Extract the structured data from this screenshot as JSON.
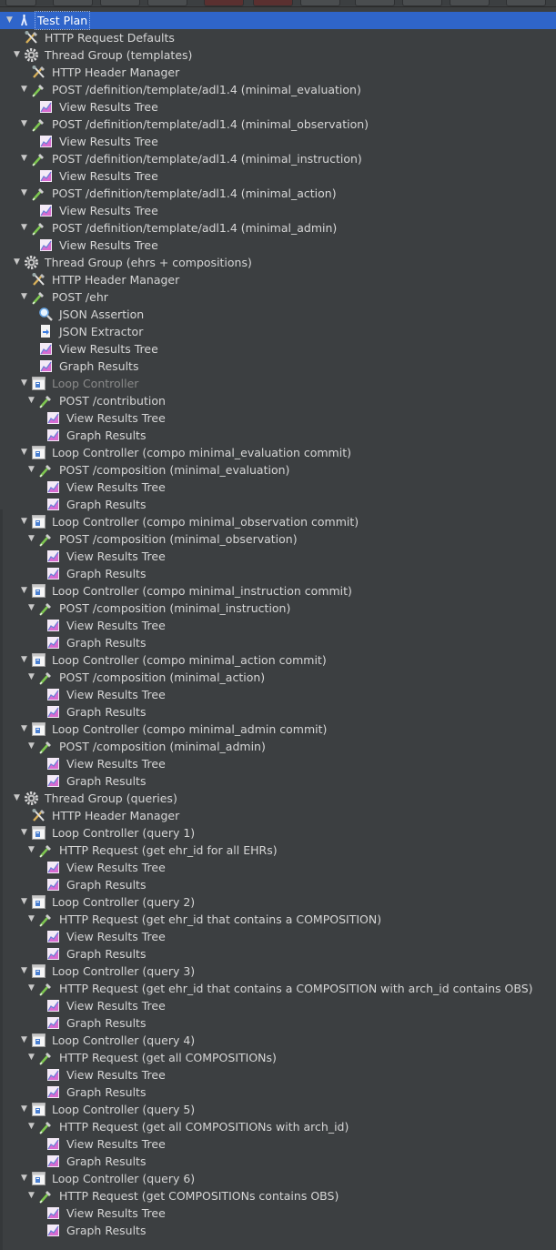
{
  "tree": [
    {
      "name": "test-plan-node",
      "icon": "test-plan-icon",
      "label": "Test Plan",
      "indent": 0,
      "toggle": "expanded",
      "selected": true
    },
    {
      "name": "http-request-defaults-node",
      "icon": "http-defaults-icon",
      "label": "HTTP Request Defaults",
      "indent": 1,
      "toggle": "none"
    },
    {
      "name": "thread-group-node",
      "icon": "gear-icon",
      "label": "Thread Group (templates)",
      "indent": 1,
      "toggle": "expanded"
    },
    {
      "name": "http-header-manager-node",
      "icon": "header-manager-icon",
      "label": "HTTP Header Manager",
      "indent": 2,
      "toggle": "none"
    },
    {
      "name": "sampler-node",
      "icon": "sampler-pipette-icon",
      "label": "POST /definition/template/adl1.4 (minimal_evaluation)",
      "indent": 2,
      "toggle": "expanded"
    },
    {
      "name": "view-results-tree-node",
      "icon": "listener-chart-icon",
      "label": "View Results Tree",
      "indent": 3,
      "toggle": "none"
    },
    {
      "name": "sampler-node",
      "icon": "sampler-pipette-icon",
      "label": "POST /definition/template/adl1.4 (minimal_observation)",
      "indent": 2,
      "toggle": "expanded"
    },
    {
      "name": "view-results-tree-node",
      "icon": "listener-chart-icon",
      "label": "View Results Tree",
      "indent": 3,
      "toggle": "none"
    },
    {
      "name": "sampler-node",
      "icon": "sampler-pipette-icon",
      "label": "POST /definition/template/adl1.4 (minimal_instruction)",
      "indent": 2,
      "toggle": "expanded"
    },
    {
      "name": "view-results-tree-node",
      "icon": "listener-chart-icon",
      "label": "View Results Tree",
      "indent": 3,
      "toggle": "none"
    },
    {
      "name": "sampler-node",
      "icon": "sampler-pipette-icon",
      "label": "POST /definition/template/adl1.4 (minimal_action)",
      "indent": 2,
      "toggle": "expanded"
    },
    {
      "name": "view-results-tree-node",
      "icon": "listener-chart-icon",
      "label": "View Results Tree",
      "indent": 3,
      "toggle": "none"
    },
    {
      "name": "sampler-node",
      "icon": "sampler-pipette-icon",
      "label": "POST /definition/template/adl1.4 (minimal_admin)",
      "indent": 2,
      "toggle": "expanded"
    },
    {
      "name": "view-results-tree-node",
      "icon": "listener-chart-icon",
      "label": "View Results Tree",
      "indent": 3,
      "toggle": "none"
    },
    {
      "name": "thread-group-node",
      "icon": "gear-icon",
      "label": "Thread Group (ehrs + compositions)",
      "indent": 1,
      "toggle": "expanded"
    },
    {
      "name": "http-header-manager-node",
      "icon": "header-manager-icon",
      "label": "HTTP Header Manager",
      "indent": 2,
      "toggle": "none"
    },
    {
      "name": "sampler-node",
      "icon": "sampler-pipette-icon",
      "label": "POST /ehr",
      "indent": 2,
      "toggle": "expanded"
    },
    {
      "name": "json-assertion-node",
      "icon": "json-assertion-icon",
      "label": "JSON Assertion",
      "indent": 3,
      "toggle": "none"
    },
    {
      "name": "json-extractor-node",
      "icon": "json-extractor-icon",
      "label": "JSON Extractor",
      "indent": 3,
      "toggle": "none"
    },
    {
      "name": "view-results-tree-node",
      "icon": "listener-chart-icon",
      "label": "View Results Tree",
      "indent": 3,
      "toggle": "none"
    },
    {
      "name": "graph-results-node",
      "icon": "listener-chart-icon",
      "label": "Graph Results",
      "indent": 3,
      "toggle": "none"
    },
    {
      "name": "loop-controller-node",
      "icon": "loop-controller-icon",
      "label": "Loop Controller",
      "indent": 2,
      "toggle": "expanded",
      "disabled": true
    },
    {
      "name": "sampler-node",
      "icon": "sampler-pipette-icon",
      "label": "POST /contribution",
      "indent": 3,
      "toggle": "expanded"
    },
    {
      "name": "view-results-tree-node",
      "icon": "listener-chart-icon",
      "label": "View Results Tree",
      "indent": 4,
      "toggle": "none"
    },
    {
      "name": "graph-results-node",
      "icon": "listener-chart-icon",
      "label": "Graph Results",
      "indent": 4,
      "toggle": "none"
    },
    {
      "name": "loop-controller-node",
      "icon": "loop-controller-icon",
      "label": "Loop Controller (compo minimal_evaluation commit)",
      "indent": 2,
      "toggle": "expanded"
    },
    {
      "name": "sampler-node",
      "icon": "sampler-pipette-icon",
      "label": "POST /composition (minimal_evaluation)",
      "indent": 3,
      "toggle": "expanded"
    },
    {
      "name": "view-results-tree-node",
      "icon": "listener-chart-icon",
      "label": "View Results Tree",
      "indent": 4,
      "toggle": "none"
    },
    {
      "name": "graph-results-node",
      "icon": "listener-chart-icon",
      "label": "Graph Results",
      "indent": 4,
      "toggle": "none"
    },
    {
      "name": "loop-controller-node",
      "icon": "loop-controller-icon",
      "label": "Loop Controller (compo minimal_observation commit)",
      "indent": 2,
      "toggle": "expanded"
    },
    {
      "name": "sampler-node",
      "icon": "sampler-pipette-icon",
      "label": "POST /composition (minimal_observation)",
      "indent": 3,
      "toggle": "expanded"
    },
    {
      "name": "view-results-tree-node",
      "icon": "listener-chart-icon",
      "label": "View Results Tree",
      "indent": 4,
      "toggle": "none"
    },
    {
      "name": "graph-results-node",
      "icon": "listener-chart-icon",
      "label": "Graph Results",
      "indent": 4,
      "toggle": "none"
    },
    {
      "name": "loop-controller-node",
      "icon": "loop-controller-icon",
      "label": "Loop Controller (compo minimal_instruction commit)",
      "indent": 2,
      "toggle": "expanded"
    },
    {
      "name": "sampler-node",
      "icon": "sampler-pipette-icon",
      "label": "POST /composition (minimal_instruction)",
      "indent": 3,
      "toggle": "expanded"
    },
    {
      "name": "view-results-tree-node",
      "icon": "listener-chart-icon",
      "label": "View Results Tree",
      "indent": 4,
      "toggle": "none"
    },
    {
      "name": "graph-results-node",
      "icon": "listener-chart-icon",
      "label": "Graph Results",
      "indent": 4,
      "toggle": "none"
    },
    {
      "name": "loop-controller-node",
      "icon": "loop-controller-icon",
      "label": "Loop Controller (compo minimal_action commit)",
      "indent": 2,
      "toggle": "expanded"
    },
    {
      "name": "sampler-node",
      "icon": "sampler-pipette-icon",
      "label": "POST /composition (minimal_action)",
      "indent": 3,
      "toggle": "expanded"
    },
    {
      "name": "view-results-tree-node",
      "icon": "listener-chart-icon",
      "label": "View Results Tree",
      "indent": 4,
      "toggle": "none"
    },
    {
      "name": "graph-results-node",
      "icon": "listener-chart-icon",
      "label": "Graph Results",
      "indent": 4,
      "toggle": "none"
    },
    {
      "name": "loop-controller-node",
      "icon": "loop-controller-icon",
      "label": "Loop Controller (compo minimal_admin commit)",
      "indent": 2,
      "toggle": "expanded"
    },
    {
      "name": "sampler-node",
      "icon": "sampler-pipette-icon",
      "label": "POST /composition (minimal_admin)",
      "indent": 3,
      "toggle": "expanded"
    },
    {
      "name": "view-results-tree-node",
      "icon": "listener-chart-icon",
      "label": "View Results Tree",
      "indent": 4,
      "toggle": "none"
    },
    {
      "name": "graph-results-node",
      "icon": "listener-chart-icon",
      "label": "Graph Results",
      "indent": 4,
      "toggle": "none"
    },
    {
      "name": "thread-group-node",
      "icon": "gear-icon",
      "label": "Thread Group (queries)",
      "indent": 1,
      "toggle": "expanded"
    },
    {
      "name": "http-header-manager-node",
      "icon": "header-manager-icon",
      "label": "HTTP Header Manager",
      "indent": 2,
      "toggle": "none"
    },
    {
      "name": "loop-controller-node",
      "icon": "loop-controller-icon",
      "label": "Loop Controller (query 1)",
      "indent": 2,
      "toggle": "expanded"
    },
    {
      "name": "sampler-node",
      "icon": "sampler-pipette-icon",
      "label": "HTTP Request (get ehr_id for all EHRs)",
      "indent": 3,
      "toggle": "expanded"
    },
    {
      "name": "view-results-tree-node",
      "icon": "listener-chart-icon",
      "label": "View Results Tree",
      "indent": 4,
      "toggle": "none"
    },
    {
      "name": "graph-results-node",
      "icon": "listener-chart-icon",
      "label": "Graph Results",
      "indent": 4,
      "toggle": "none"
    },
    {
      "name": "loop-controller-node",
      "icon": "loop-controller-icon",
      "label": "Loop Controller (query 2)",
      "indent": 2,
      "toggle": "expanded"
    },
    {
      "name": "sampler-node",
      "icon": "sampler-pipette-icon",
      "label": "HTTP Request (get ehr_id that contains a COMPOSITION)",
      "indent": 3,
      "toggle": "expanded"
    },
    {
      "name": "view-results-tree-node",
      "icon": "listener-chart-icon",
      "label": "View Results Tree",
      "indent": 4,
      "toggle": "none"
    },
    {
      "name": "graph-results-node",
      "icon": "listener-chart-icon",
      "label": "Graph Results",
      "indent": 4,
      "toggle": "none"
    },
    {
      "name": "loop-controller-node",
      "icon": "loop-controller-icon",
      "label": "Loop Controller (query 3)",
      "indent": 2,
      "toggle": "expanded"
    },
    {
      "name": "sampler-node",
      "icon": "sampler-pipette-icon",
      "label": "HTTP Request (get ehr_id that contains a COMPOSITION with arch_id contains OBS)",
      "indent": 3,
      "toggle": "expanded"
    },
    {
      "name": "view-results-tree-node",
      "icon": "listener-chart-icon",
      "label": "View Results Tree",
      "indent": 4,
      "toggle": "none"
    },
    {
      "name": "graph-results-node",
      "icon": "listener-chart-icon",
      "label": "Graph Results",
      "indent": 4,
      "toggle": "none"
    },
    {
      "name": "loop-controller-node",
      "icon": "loop-controller-icon",
      "label": "Loop Controller (query 4)",
      "indent": 2,
      "toggle": "expanded"
    },
    {
      "name": "sampler-node",
      "icon": "sampler-pipette-icon",
      "label": "HTTP Request (get all COMPOSITIONs)",
      "indent": 3,
      "toggle": "expanded"
    },
    {
      "name": "view-results-tree-node",
      "icon": "listener-chart-icon",
      "label": "View Results Tree",
      "indent": 4,
      "toggle": "none"
    },
    {
      "name": "graph-results-node",
      "icon": "listener-chart-icon",
      "label": "Graph Results",
      "indent": 4,
      "toggle": "none"
    },
    {
      "name": "loop-controller-node",
      "icon": "loop-controller-icon",
      "label": "Loop Controller (query 5)",
      "indent": 2,
      "toggle": "expanded"
    },
    {
      "name": "sampler-node",
      "icon": "sampler-pipette-icon",
      "label": "HTTP Request (get all COMPOSITIONs with arch_id)",
      "indent": 3,
      "toggle": "expanded"
    },
    {
      "name": "view-results-tree-node",
      "icon": "listener-chart-icon",
      "label": "View Results Tree",
      "indent": 4,
      "toggle": "none"
    },
    {
      "name": "graph-results-node",
      "icon": "listener-chart-icon",
      "label": "Graph Results",
      "indent": 4,
      "toggle": "none"
    },
    {
      "name": "loop-controller-node",
      "icon": "loop-controller-icon",
      "label": "Loop Controller (query 6)",
      "indent": 2,
      "toggle": "expanded"
    },
    {
      "name": "sampler-node",
      "icon": "sampler-pipette-icon",
      "label": "HTTP Request (get COMPOSITIONs contains OBS)",
      "indent": 3,
      "toggle": "expanded"
    },
    {
      "name": "view-results-tree-node",
      "icon": "listener-chart-icon",
      "label": "View Results Tree",
      "indent": 4,
      "toggle": "none"
    },
    {
      "name": "graph-results-node",
      "icon": "listener-chart-icon",
      "label": "Graph Results",
      "indent": 4,
      "toggle": "none"
    }
  ],
  "colors": {
    "background": "#3c3f41",
    "selection": "#2f65ca",
    "text": "#d6d6d6",
    "disabled_text": "#8a8a8a"
  }
}
